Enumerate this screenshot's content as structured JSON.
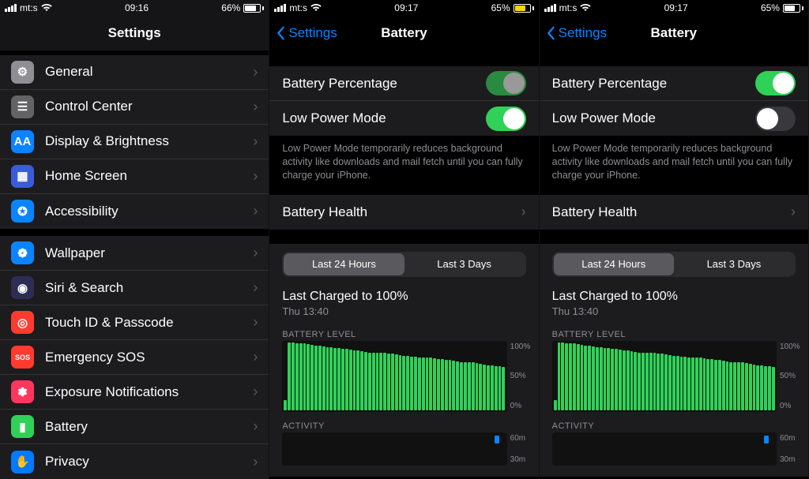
{
  "panes": [
    {
      "status": {
        "carrier": "mt:s",
        "time": "09:16",
        "battery_pct": "66%",
        "battery_fill": 66,
        "low_power": false
      },
      "header": {
        "title": "Settings",
        "back": null
      }
    },
    {
      "status": {
        "carrier": "mt:s",
        "time": "09:17",
        "battery_pct": "65%",
        "battery_fill": 65,
        "low_power": true
      },
      "header": {
        "title": "Battery",
        "back": "Settings"
      }
    },
    {
      "status": {
        "carrier": "mt:s",
        "time": "09:17",
        "battery_pct": "65%",
        "battery_fill": 65,
        "low_power": false
      },
      "header": {
        "title": "Battery",
        "back": "Settings"
      }
    }
  ],
  "settings_list_a": [
    {
      "label": "General",
      "icon_color": "i-gray",
      "glyph": "⚙"
    },
    {
      "label": "Control Center",
      "icon_color": "i-gray2",
      "glyph": "☰"
    },
    {
      "label": "Display & Brightness",
      "icon_color": "i-blue",
      "glyph": "AA"
    },
    {
      "label": "Home Screen",
      "icon_color": "i-indigo",
      "glyph": "▦"
    },
    {
      "label": "Accessibility",
      "icon_color": "i-blue",
      "glyph": "✪"
    }
  ],
  "settings_list_b": [
    {
      "label": "Wallpaper",
      "icon_color": "i-blue",
      "glyph": "❁"
    },
    {
      "label": "Siri & Search",
      "icon_color": "i-purple",
      "glyph": "◉"
    },
    {
      "label": "Touch ID & Passcode",
      "icon_color": "i-red",
      "glyph": "◎"
    },
    {
      "label": "Emergency SOS",
      "icon_color": "i-red",
      "glyph": "SOS"
    },
    {
      "label": "Exposure Notifications",
      "icon_color": "i-redpink",
      "glyph": "✽"
    },
    {
      "label": "Battery",
      "icon_color": "i-green",
      "glyph": "▮"
    },
    {
      "label": "Privacy",
      "icon_color": "i-bluei",
      "glyph": "✋"
    }
  ],
  "battery": {
    "percentage_label": "Battery Percentage",
    "low_power_label": "Low Power Mode",
    "footer": "Low Power Mode temporarily reduces background activity like downloads and mail fetch until you can fully charge your iPhone.",
    "health_label": "Battery Health",
    "segmented": [
      "Last 24 Hours",
      "Last 3 Days"
    ],
    "selected_segment": 0,
    "last_charged_title": "Last Charged to 100%",
    "last_charged_time": "Thu 13:40",
    "level_title": "BATTERY LEVEL",
    "level_axis": [
      "100%",
      "50%",
      "0%"
    ],
    "activity_title": "ACTIVITY",
    "activity_axis": [
      "60m",
      "30m"
    ]
  },
  "pane1_toggles": {
    "percentage": true,
    "low_power": true,
    "percentage_dim": true
  },
  "pane2_toggles": {
    "percentage": true,
    "low_power": false,
    "percentage_dim": false
  },
  "chart_data": {
    "type": "bar",
    "title": "BATTERY LEVEL",
    "ylabel": "%",
    "ylim": [
      0,
      100
    ],
    "y_ticks": [
      0,
      50,
      100
    ],
    "categories_note": "hourly samples over last ~24h",
    "values": [
      15,
      100,
      100,
      99,
      99,
      98,
      97,
      96,
      95,
      95,
      94,
      93,
      93,
      92,
      91,
      90,
      90,
      89,
      88,
      88,
      87,
      86,
      85,
      85,
      84,
      84,
      84,
      83,
      83,
      82,
      81,
      80,
      80,
      79,
      79,
      78,
      78,
      77,
      77,
      76,
      75,
      75,
      74,
      74,
      73,
      72,
      71,
      71,
      70,
      70,
      69,
      68,
      67,
      66,
      66,
      65,
      65,
      64
    ]
  },
  "activity_chart": {
    "type": "bar",
    "title": "ACTIVITY",
    "ylabel": "minutes",
    "ylim": [
      0,
      60
    ],
    "y_ticks": [
      30,
      60
    ]
  }
}
